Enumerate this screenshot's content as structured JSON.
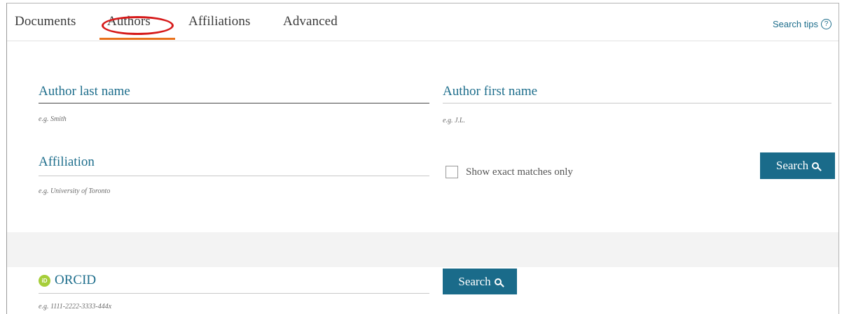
{
  "tabs": [
    {
      "label": "Documents"
    },
    {
      "label": "Authors"
    },
    {
      "label": "Affiliations"
    },
    {
      "label": "Advanced"
    }
  ],
  "search_tips": {
    "label": "Search tips",
    "icon": "help-icon"
  },
  "author_last_name": {
    "label": "Author last name",
    "hint": "e.g. Smith"
  },
  "author_first_name": {
    "label": "Author first name",
    "hint": "e.g. J.L."
  },
  "affiliation": {
    "label": "Affiliation",
    "hint": "e.g. University of Toronto"
  },
  "exact_matches": {
    "label": "Show exact matches only",
    "checked": false
  },
  "search_button": {
    "label": "Search",
    "icon": "search-icon"
  },
  "orcid": {
    "label": "ORCID",
    "hint": "e.g. 1111-2222-3333-444x",
    "icon": "orcid-icon"
  },
  "orcid_search_button": {
    "label": "Search"
  },
  "colors": {
    "accent": "#1a6b8a",
    "active_tab": "#e9711c",
    "annotation": "#d61a1a",
    "orcid": "#a6ce39"
  }
}
